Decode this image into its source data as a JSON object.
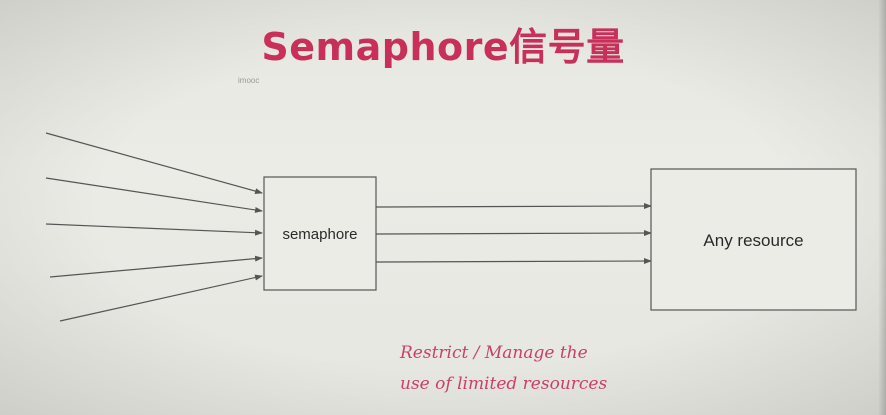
{
  "title": "Semaphore信号量",
  "watermark": "imooc",
  "nodes": {
    "semaphore": {
      "label": "semaphore"
    },
    "resource": {
      "label": "Any resource"
    }
  },
  "caption": {
    "line1": "Restrict / Manage the",
    "line2": "use of limited resources"
  },
  "colors": {
    "title": "#c8305a",
    "caption": "#c8416a",
    "line": "#555555",
    "background": "#e9e9e3"
  }
}
